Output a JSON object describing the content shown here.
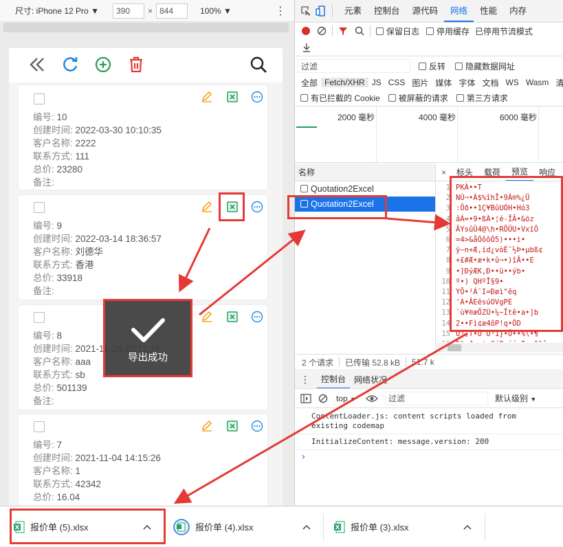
{
  "device_toolbar": {
    "dimensions_label": "尺寸: iPhone 12 Pro",
    "width": "390",
    "times": "×",
    "height": "844",
    "zoom": "100%"
  },
  "app": {
    "toolbar_icons": [
      "double-chevron-left-icon",
      "refresh-icon",
      "add-icon",
      "trash-icon",
      "search-icon"
    ],
    "records": [
      {
        "id_label": "编号: ",
        "id": "10",
        "created_label": "创建时间: ",
        "created": "2022-03-30 10:10:35",
        "customer_label": "客户名称: ",
        "customer": "2222",
        "contact_label": "联系方式: ",
        "contact": "111",
        "total_label": "总价: ",
        "total": "23280",
        "note_label": "备注: ",
        "note": ""
      },
      {
        "id_label": "编号: ",
        "id": "9",
        "created_label": "创建时间: ",
        "created": "2022-03-14 18:36:57",
        "customer_label": "客户名称: ",
        "customer": "刘德华",
        "contact_label": "联系方式: ",
        "contact": "香港",
        "total_label": "总价: ",
        "total": "33918",
        "note_label": "备注: ",
        "note": ""
      },
      {
        "id_label": "编号: ",
        "id": "8",
        "created_label": "创建时间: ",
        "created": "2021-11-26 20:11:16",
        "customer_label": "客户名称: ",
        "customer": "aaa",
        "contact_label": "联系方式: ",
        "contact": "sb",
        "total_label": "总价: ",
        "total": "501139",
        "note_label": "备注: ",
        "note": ""
      },
      {
        "id_label": "编号: ",
        "id": "7",
        "created_label": "创建时间: ",
        "created": "2021-11-04 14:15:26",
        "customer_label": "客户名称: ",
        "customer": "1",
        "contact_label": "联系方式: ",
        "contact": "42342",
        "total_label": "总价: ",
        "total": "16.04",
        "note_label": "备注: ",
        "note": ""
      }
    ],
    "toast": "导出成功"
  },
  "devtools": {
    "main_tabs": [
      "元素",
      "控制台",
      "源代码",
      "网络",
      "性能",
      "内存"
    ],
    "active_main_tab": "网络",
    "preserve_log": "保留日志",
    "disable_cache": "停用缓存",
    "throttling": "已停用节流模式",
    "filter_placeholder": "过滤",
    "invert": "反转",
    "hide_data_urls": "隐藏数据网址",
    "type_filters": [
      "全部",
      "Fetch/XHR",
      "JS",
      "CSS",
      "图片",
      "媒体",
      "字体",
      "文档",
      "WS",
      "Wasm",
      "清单"
    ],
    "blocked_cookies": "有已拦截的 Cookie",
    "blocked_requests": "被屏蔽的请求",
    "third_party": "第三方请求",
    "timeline_ticks": [
      "2000 毫秒",
      "4000 毫秒",
      "6000 毫秒"
    ],
    "name_header": "名称",
    "requests": [
      "Quotation2Excel",
      "Quotation2Excel"
    ],
    "detail_tabs": [
      "×",
      "标头",
      "载荷",
      "预览",
      "响应"
    ],
    "active_detail_tab": "预览",
    "preview_lines": [
      "PK\u0003\u0004\u0014\u0000\b\b\b\u0000À••T",
      "NÚ¬•À$%îh\u001bÎ\u0017\u0004•9Á®%¿Ü",
      ":Õð••1Ç\u001d¥B\u0013ûUÓH•Hó3",
      "âÁ=•9•\u0003\u0013ßÀ•¦é-ÏÃ•&öz",
      "ÄYsûÛ4@\\h•R\u001b\u0012ÕÜU•VxîÔ",
      "=4>&\u0017åÓôôÒ5\u001e\u0012)•••i•",
      "ÿ~n+Æ,íd¿vòÈ¯½Þ•µbß¢",
      "+£#Æ•æ•k•û¬•)îÃ••\u0003\u0013E",
      "\u001b•]ÐýÆK,Ð••ü••ý\u001bb•",
      "º•\u0018\u0001\u0013)\u0019   QHºÎ§9•",
      "YÕ•²Á\u001b¯I=Ðøì\"\u001a\u0011\u0013êq",
      "'A•Â\u0012EêsúOVg\u001b\u0015\u0011PE",
      "`ù¥®æÕZÙ•\u0011¼~Ïtê•a•]b",
      "2••F\u0011ì¢æ4ô\u001b\u0017P!q•ÔD",
      "U³,T•Ó  U³1}•Ô••%\\•¶",
      "Ð}«J•:isCé8•ééeI••1&ê"
    ],
    "status_requests": "2 个请求",
    "status_transferred": "已传输 52.8 kB",
    "status_size": "51.7 k",
    "drawer_tabs": [
      "控制台",
      "网络状况"
    ],
    "context": "top",
    "console_filter_placeholder": "过滤",
    "log_levels": "默认级别",
    "console_messages": [
      "ContentLoader.js: content scripts loaded from existing codemap",
      "InitializeContent: message.version: 200"
    ],
    "prompt": "›"
  },
  "downloads": [
    {
      "name": "报价单 (5).xlsx"
    },
    {
      "name": "报价单 (4).xlsx"
    },
    {
      "name": "报价单 (3).xlsx"
    }
  ],
  "colors": {
    "accent_blue": "#1a73e8",
    "app_blue": "#1e88e5",
    "app_green": "#2e9e5b",
    "app_red": "#e53935",
    "annotation_red": "#e53935",
    "edit_orange": "#f5a623",
    "excel_green": "#21a366",
    "request_selected": "#1a73e8"
  }
}
